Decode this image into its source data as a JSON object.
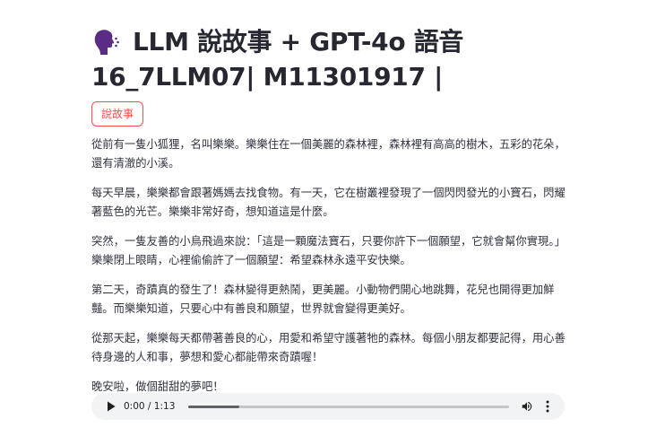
{
  "header": {
    "icon": "speaking-head-icon",
    "title_line1": "LLM 說故事 + GPT-4o 語音",
    "title_line2": "16_7LLM07| M11301917 |"
  },
  "actions": {
    "tell_story_label": "說故事"
  },
  "story": {
    "paragraphs": [
      "從前有一隻小狐狸，名叫樂樂。樂樂住在一個美麗的森林裡，森林裡有高高的樹木，五彩的花朵，還有清澈的小溪。",
      "每天早晨，樂樂都會跟著媽媽去找食物。有一天，它在樹叢裡發現了一個閃閃發光的小寶石，閃耀著藍色的光芒。樂樂非常好奇，想知道這是什麼。",
      "突然，一隻友善的小鳥飛過來說：「這是一顆魔法寶石，只要你許下一個願望，它就會幫你實現。」樂樂閉上眼睛，心裡偷偷許了一個願望：希望森林永遠平安快樂。",
      "第二天，奇蹟真的發生了！森林變得更熱鬧，更美麗。小動物們開心地跳舞，花兒也開得更加鮮豔。而樂樂知道，只要心中有善良和願望，世界就會變得更美好。",
      "從那天起，樂樂每天都帶著善良的心，用愛和希望守護著牠的森林。每個小朋友都要記得，用心善待身邊的人和事，夢想和愛心都能帶來奇蹟喔！",
      "晚安啦，做個甜甜的夢吧！"
    ]
  },
  "audio": {
    "time_display": "0:00 / 1:13",
    "progress_fraction": 0.16,
    "icons": {
      "play": "play-icon",
      "volume": "volume-icon",
      "more": "more-vert-icon"
    },
    "colors": {
      "track_bg": "#f1f3f4",
      "progress_track": "#c4c7c5",
      "progress_fill": "#5f6368"
    }
  },
  "colors": {
    "accent": "#ff4b4b",
    "text": "#31333f",
    "title": "#262730",
    "icon_purple": "#5b2c83"
  }
}
